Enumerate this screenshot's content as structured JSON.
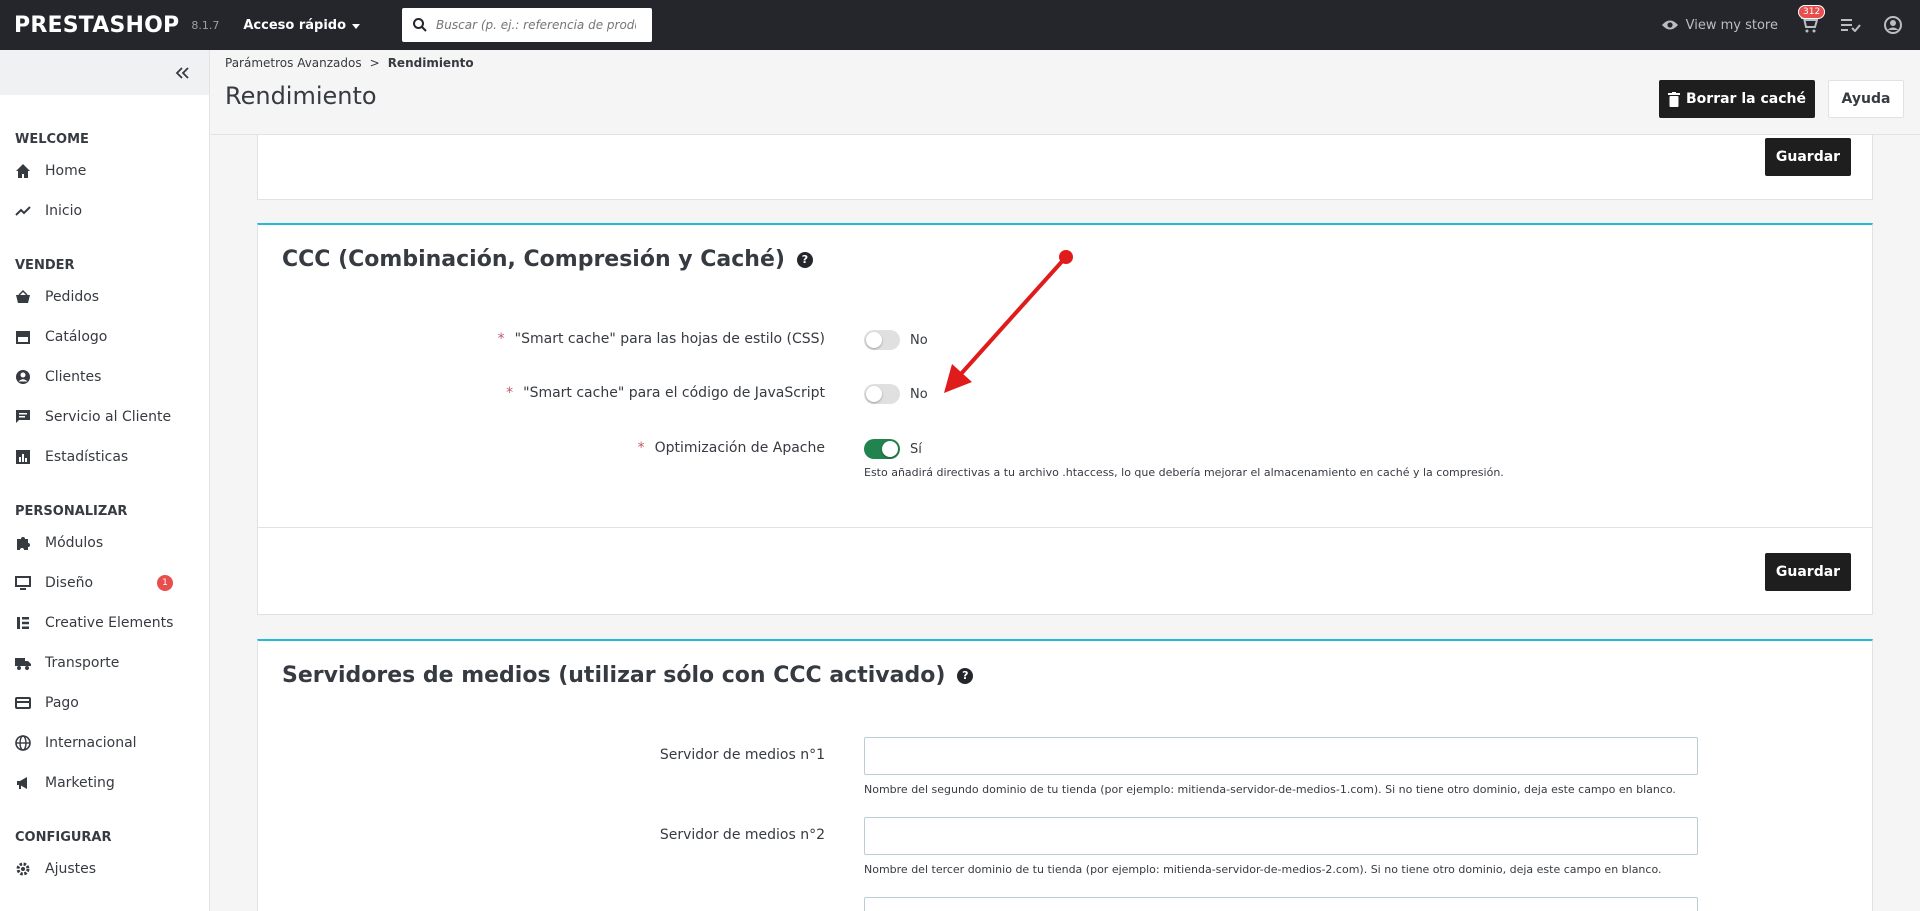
{
  "topbar": {
    "logo": "PRESTASHOP",
    "version": "8.1.7",
    "quick_access": "Acceso rápido",
    "search_placeholder": "Buscar (p. ej.: referencia de producto,",
    "view_store": "View my store",
    "notif_count": "312"
  },
  "sidebar": {
    "sections": [
      {
        "title": "WELCOME",
        "items": [
          {
            "label": "Home",
            "icon": "home-icon"
          },
          {
            "label": "Inicio",
            "icon": "trend-icon"
          }
        ]
      },
      {
        "title": "VENDER",
        "items": [
          {
            "label": "Pedidos",
            "icon": "basket-icon"
          },
          {
            "label": "Catálogo",
            "icon": "store-icon"
          },
          {
            "label": "Clientes",
            "icon": "user-icon"
          },
          {
            "label": "Servicio al Cliente",
            "icon": "chat-icon"
          },
          {
            "label": "Estadísticas",
            "icon": "chart-icon"
          }
        ]
      },
      {
        "title": "PERSONALIZAR",
        "items": [
          {
            "label": "Módulos",
            "icon": "puzzle-icon"
          },
          {
            "label": "Diseño",
            "icon": "monitor-icon",
            "badge": "1"
          },
          {
            "label": "Creative Elements",
            "icon": "elements-icon"
          },
          {
            "label": "Transporte",
            "icon": "truck-icon"
          },
          {
            "label": "Pago",
            "icon": "card-icon"
          },
          {
            "label": "Internacional",
            "icon": "globe-icon"
          },
          {
            "label": "Marketing",
            "icon": "megaphone-icon"
          }
        ]
      },
      {
        "title": "CONFIGURAR",
        "items": [
          {
            "label": "Ajustes",
            "icon": "gear-icon"
          }
        ]
      }
    ]
  },
  "header": {
    "breadcrumb_parent": "Parámetros Avanzados",
    "breadcrumb_sep": ">",
    "breadcrumb_current": "Rendimiento",
    "title": "Rendimiento",
    "clear_cache": "Borrar la caché",
    "help": "Ayuda"
  },
  "panel_top": {
    "save": "Guardar"
  },
  "ccc": {
    "title": "CCC (Combinación, Compresión y Caché)",
    "help_icon": "?",
    "rows": [
      {
        "label": "\"Smart cache\" para las hojas de estilo (CSS)",
        "value": "No",
        "on": false
      },
      {
        "label": "\"Smart cache\" para el código de JavaScript",
        "value": "No",
        "on": false
      },
      {
        "label": "Optimización de Apache",
        "value": "Sí",
        "on": true,
        "help": "Esto añadirá directivas a tu archivo .htaccess, lo que debería mejorar el almacenamiento en caché y la compresión."
      }
    ],
    "save": "Guardar"
  },
  "media": {
    "title": "Servidores de medios (utilizar sólo con CCC activado)",
    "help_icon": "?",
    "server1_label": "Servidor de medios n°1",
    "server1_help": "Nombre del segundo dominio de tu tienda (por ejemplo: mitienda-servidor-de-medios-1.com). Si no tiene otro dominio, deja este campo en blanco.",
    "server1_value": "",
    "server2_label": "Servidor de medios n°2",
    "server2_help": "Nombre del tercer dominio de tu tienda (por ejemplo: mitienda-servidor-de-medios-2.com). Si no tiene otro dominio, deja este campo en blanco.",
    "server2_value": ""
  },
  "colors": {
    "accent": "#25b9d7",
    "topbar": "#25262b",
    "toggle_on": "#21834d",
    "badge": "#e84e4e",
    "annotation_arrow": "#e01b1b"
  },
  "required_mark": "*"
}
